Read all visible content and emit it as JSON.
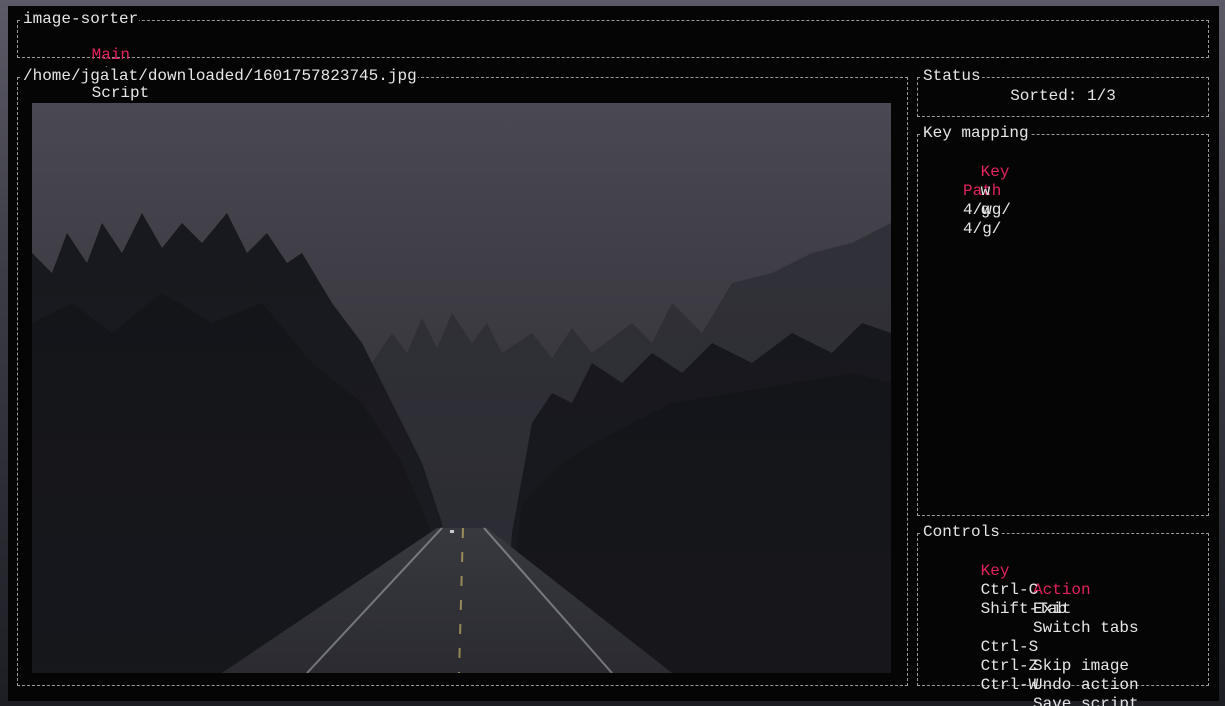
{
  "app": {
    "title": "image-sorter",
    "tabs": [
      {
        "label": "Main",
        "active": true
      },
      {
        "label": "Script",
        "active": false
      }
    ],
    "tab_separator": "|"
  },
  "image_panel": {
    "title": "/home/jgalat/downloaded/1601757823745.jpg"
  },
  "status": {
    "title": "Status",
    "text": "Sorted: 1/3"
  },
  "key_mapping": {
    "title": "Key mapping",
    "headers": {
      "key": "Key",
      "path": "Path"
    },
    "rows": [
      {
        "key": "w",
        "path": "4/wg/"
      },
      {
        "key": "g",
        "path": "4/g/"
      }
    ]
  },
  "controls": {
    "title": "Controls",
    "headers": {
      "key": "Key",
      "action": "Action"
    },
    "rows": [
      {
        "key": "Ctrl-C",
        "action": "Exit"
      },
      {
        "key": "Shift-Tab",
        "action": "Switch tabs"
      },
      {
        "key": "Ctrl-S",
        "action": "Skip image"
      },
      {
        "key": "Ctrl-Z",
        "action": "Undo action"
      },
      {
        "key": "Ctrl-W",
        "action": "Save script"
      }
    ]
  },
  "colors": {
    "accent": "#e0245e",
    "background": "#050505",
    "text": "#e6e6e6",
    "border": "#9a9a9a"
  }
}
